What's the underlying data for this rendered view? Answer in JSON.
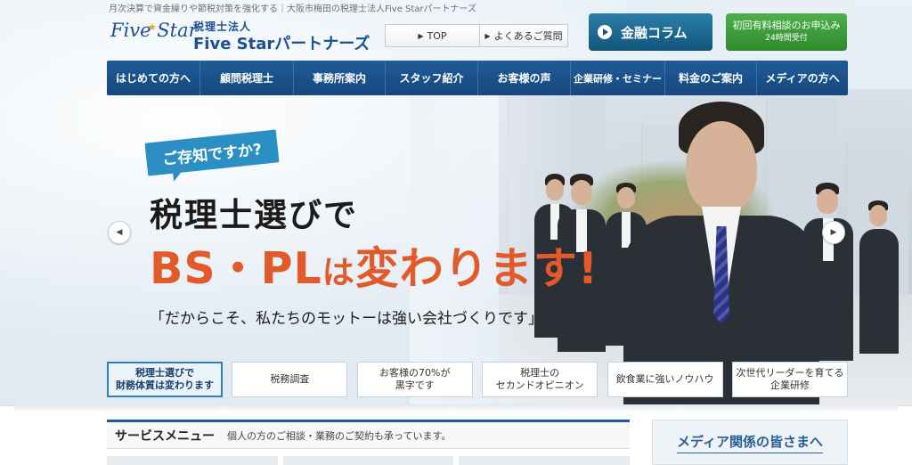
{
  "header": {
    "tagline": "月次決算で資金繰りや節税対策を強化する｜大阪市梅田の税理士法人Five Starパートナーズ",
    "logo_mark": "Five Star",
    "logo_sub": "税理士法人",
    "logo_name": "Five Starパートナーズ",
    "util_links": [
      "TOP",
      "よくあるご質問"
    ],
    "column_button": "金融コラム",
    "consult_button_line1": "初回有料相談のお申込み",
    "consult_button_line2": "24時間受付"
  },
  "nav": {
    "items": [
      "はじめての方へ",
      "顧問税理士",
      "事務所案内",
      "スタッフ紹介",
      "お客様の声",
      "企業研修・セミナー",
      "料金のご案内",
      "メディアの方へ"
    ]
  },
  "hero": {
    "bubble": "ご存知ですか?",
    "headline1": "税理士選びで",
    "headline2_main": "BS・PL",
    "headline2_small": "は",
    "headline2_rest": "変わります!",
    "motto": "「だからこそ、私たちのモットーは強い会社づくりです」"
  },
  "tabs": [
    {
      "line1": "税理士選びで",
      "line2": "財務体質は変わります",
      "active": true
    },
    {
      "line1": "税務調査",
      "line2": "",
      "active": false
    },
    {
      "line1": "お客様の70%が",
      "line2": "黒字です",
      "active": false
    },
    {
      "line1": "税理士の",
      "line2": "セカンドオピニオン",
      "active": false
    },
    {
      "line1": "飲食業に強いノウハウ",
      "line2": "",
      "active": false
    },
    {
      "line1": "次世代リーダーを育てる",
      "line2": "企業研修",
      "active": false
    }
  ],
  "services": {
    "title": "サービスメニュー",
    "note": "個人の方のご相談・業務のご契約も承っています。"
  },
  "media": {
    "label": "メディア関係の皆さまへ"
  },
  "colors": {
    "brand_blue": "#1b4f96",
    "nav_blue": "#1f5b98",
    "accent_orange": "#e2592a",
    "consult_green": "#3e9e3b",
    "column_teal": "#11557c"
  }
}
